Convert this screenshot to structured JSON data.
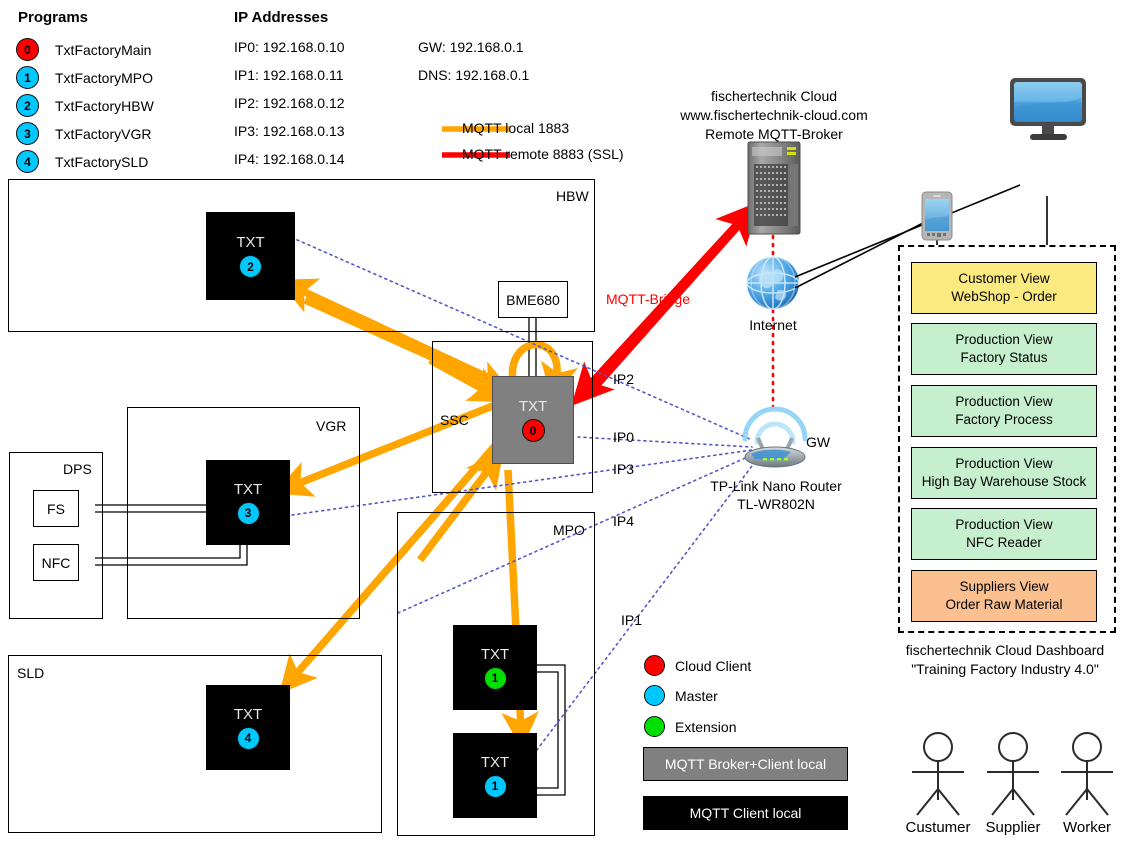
{
  "legend_programs": {
    "title": "Programs",
    "items": [
      {
        "num": "0",
        "color": "red",
        "label": "TxtFactoryMain"
      },
      {
        "num": "1",
        "color": "cyan",
        "label": "TxtFactoryMPO"
      },
      {
        "num": "2",
        "color": "cyan",
        "label": "TxtFactoryHBW"
      },
      {
        "num": "3",
        "color": "cyan",
        "label": "TxtFactoryVGR"
      },
      {
        "num": "4",
        "color": "cyan",
        "label": "TxtFactorySLD"
      }
    ]
  },
  "legend_ip": {
    "title": "IP Addresses",
    "items": [
      "IP0: 192.168.0.10",
      "IP1: 192.168.0.11",
      "IP2: 192.168.0.12",
      "IP3: 192.168.0.13",
      "IP4: 192.168.0.14"
    ],
    "gateway": "GW: 192.168.0.1",
    "dns": "DNS: 192.168.0.1"
  },
  "legend_links": {
    "local": "MQTT local 1883",
    "remote": "MQTT remote 8883 (SSL)",
    "local_color": "#FFA500",
    "remote_color": "#FF0000"
  },
  "cloud": {
    "line1": "fischertechnik Cloud",
    "line2": "www.fischertechnik-cloud.com",
    "line3": "Remote MQTT-Broker",
    "internet_label": "Internet",
    "bridge_label": "MQTT-Bridge"
  },
  "router": {
    "gw_label": "GW",
    "name_line1": "TP-Link Nano Router",
    "name_line2": "TL-WR802N"
  },
  "ip_callouts": [
    {
      "id": "IP2",
      "label": "IP2"
    },
    {
      "id": "IP0",
      "label": "IP0"
    },
    {
      "id": "IP3",
      "label": "IP3"
    },
    {
      "id": "IP4",
      "label": "IP4"
    },
    {
      "id": "IP1",
      "label": "IP1"
    }
  ],
  "stations": {
    "hbw": {
      "title": "HBW",
      "txt": {
        "label": "TXT",
        "num": "2",
        "color": "cyan"
      }
    },
    "sensor": {
      "label": "BME680"
    },
    "ssc": {
      "title": "SSC",
      "txt": {
        "label": "TXT",
        "num": "0",
        "color": "red"
      }
    },
    "vgr": {
      "title": "VGR",
      "txt": {
        "label": "TXT",
        "num": "3",
        "color": "cyan"
      }
    },
    "dps": {
      "title": "DPS",
      "fs": "FS",
      "nfc": "NFC"
    },
    "sld": {
      "title": "SLD",
      "txt": {
        "label": "TXT",
        "num": "4",
        "color": "cyan"
      }
    },
    "mpo": {
      "title": "MPO",
      "txt_ext": {
        "label": "TXT",
        "num": "1",
        "color": "green"
      },
      "txt_master": {
        "label": "TXT",
        "num": "1",
        "color": "cyan"
      }
    }
  },
  "node_legend": {
    "items": [
      {
        "color": "red",
        "label": "Cloud Client"
      },
      {
        "color": "cyan",
        "label": "Master"
      },
      {
        "color": "green",
        "label": "Extension"
      }
    ],
    "broker_box": "MQTT Broker+Client local",
    "client_box": "MQTT Client local"
  },
  "dashboard": {
    "cards": [
      {
        "line1": "Customer View",
        "line2": "WebShop - Order",
        "color": "#FAEA7F"
      },
      {
        "line1": "Production View",
        "line2": "Factory Status",
        "color": "#C6EFCE"
      },
      {
        "line1": "Production View",
        "line2": "Factory Process",
        "color": "#C6EFCE"
      },
      {
        "line1": "Production View",
        "line2": "High Bay Warehouse Stock",
        "color": "#C6EFCE"
      },
      {
        "line1": "Production View",
        "line2": "NFC Reader",
        "color": "#C6EFCE"
      },
      {
        "line1": "Suppliers View",
        "line2": "Order Raw Material",
        "color": "#FAC090"
      }
    ],
    "caption_line1": "fischertechnik Cloud Dashboard",
    "caption_line2": "\"Training Factory Industry 4.0\""
  },
  "actors": [
    {
      "label": "Custumer"
    },
    {
      "label": "Supplier"
    },
    {
      "label": "Worker"
    }
  ]
}
